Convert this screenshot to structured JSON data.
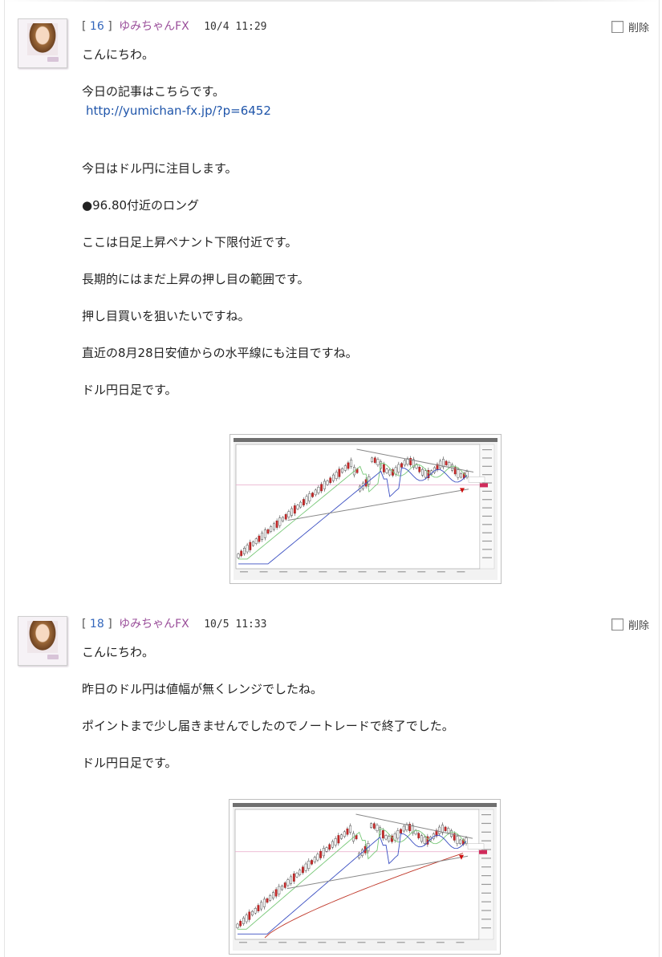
{
  "posts": [
    {
      "number": "16",
      "author": "ゆみちゃんFX",
      "date": "10/4 11:29",
      "delete_label": "削除",
      "lines": [
        "こんにちわ。",
        "",
        "今日の記事はこちらです。",
        "http://yumichan-fx.jp/?p=6452",
        "",
        "",
        "今日はドル円に注目します。",
        "",
        "●96.80付近のロング",
        "",
        "ここは日足上昇ペナント下限付近です。",
        "",
        "長期的にはまだ上昇の押し目の範囲です。",
        "",
        "押し目買いを狙いたいですね。",
        "",
        "直近の8月28日安値からの水平線にも注目ですね。",
        "",
        "ドル円日足です。"
      ]
    },
    {
      "number": "18",
      "author": "ゆみちゃんFX",
      "date": "10/5 11:33",
      "delete_label": "削除",
      "lines": [
        "こんにちわ。",
        "",
        "昨日のドル円は値幅が無くレンジでしたね。",
        "",
        "ポイントまで少し届きませんでしたのでノートレードで終了でした。",
        "",
        "ドル円日足です。"
      ]
    }
  ],
  "icons": {
    "avatar": "profile-photo-icon",
    "checkbox": "checkbox-icon"
  },
  "colors": {
    "number": "#3366bb",
    "author": "#9a4e9a",
    "link": "#1f55aa",
    "candle_up": "#1a1a1a",
    "candle_down": "#cc2222"
  }
}
